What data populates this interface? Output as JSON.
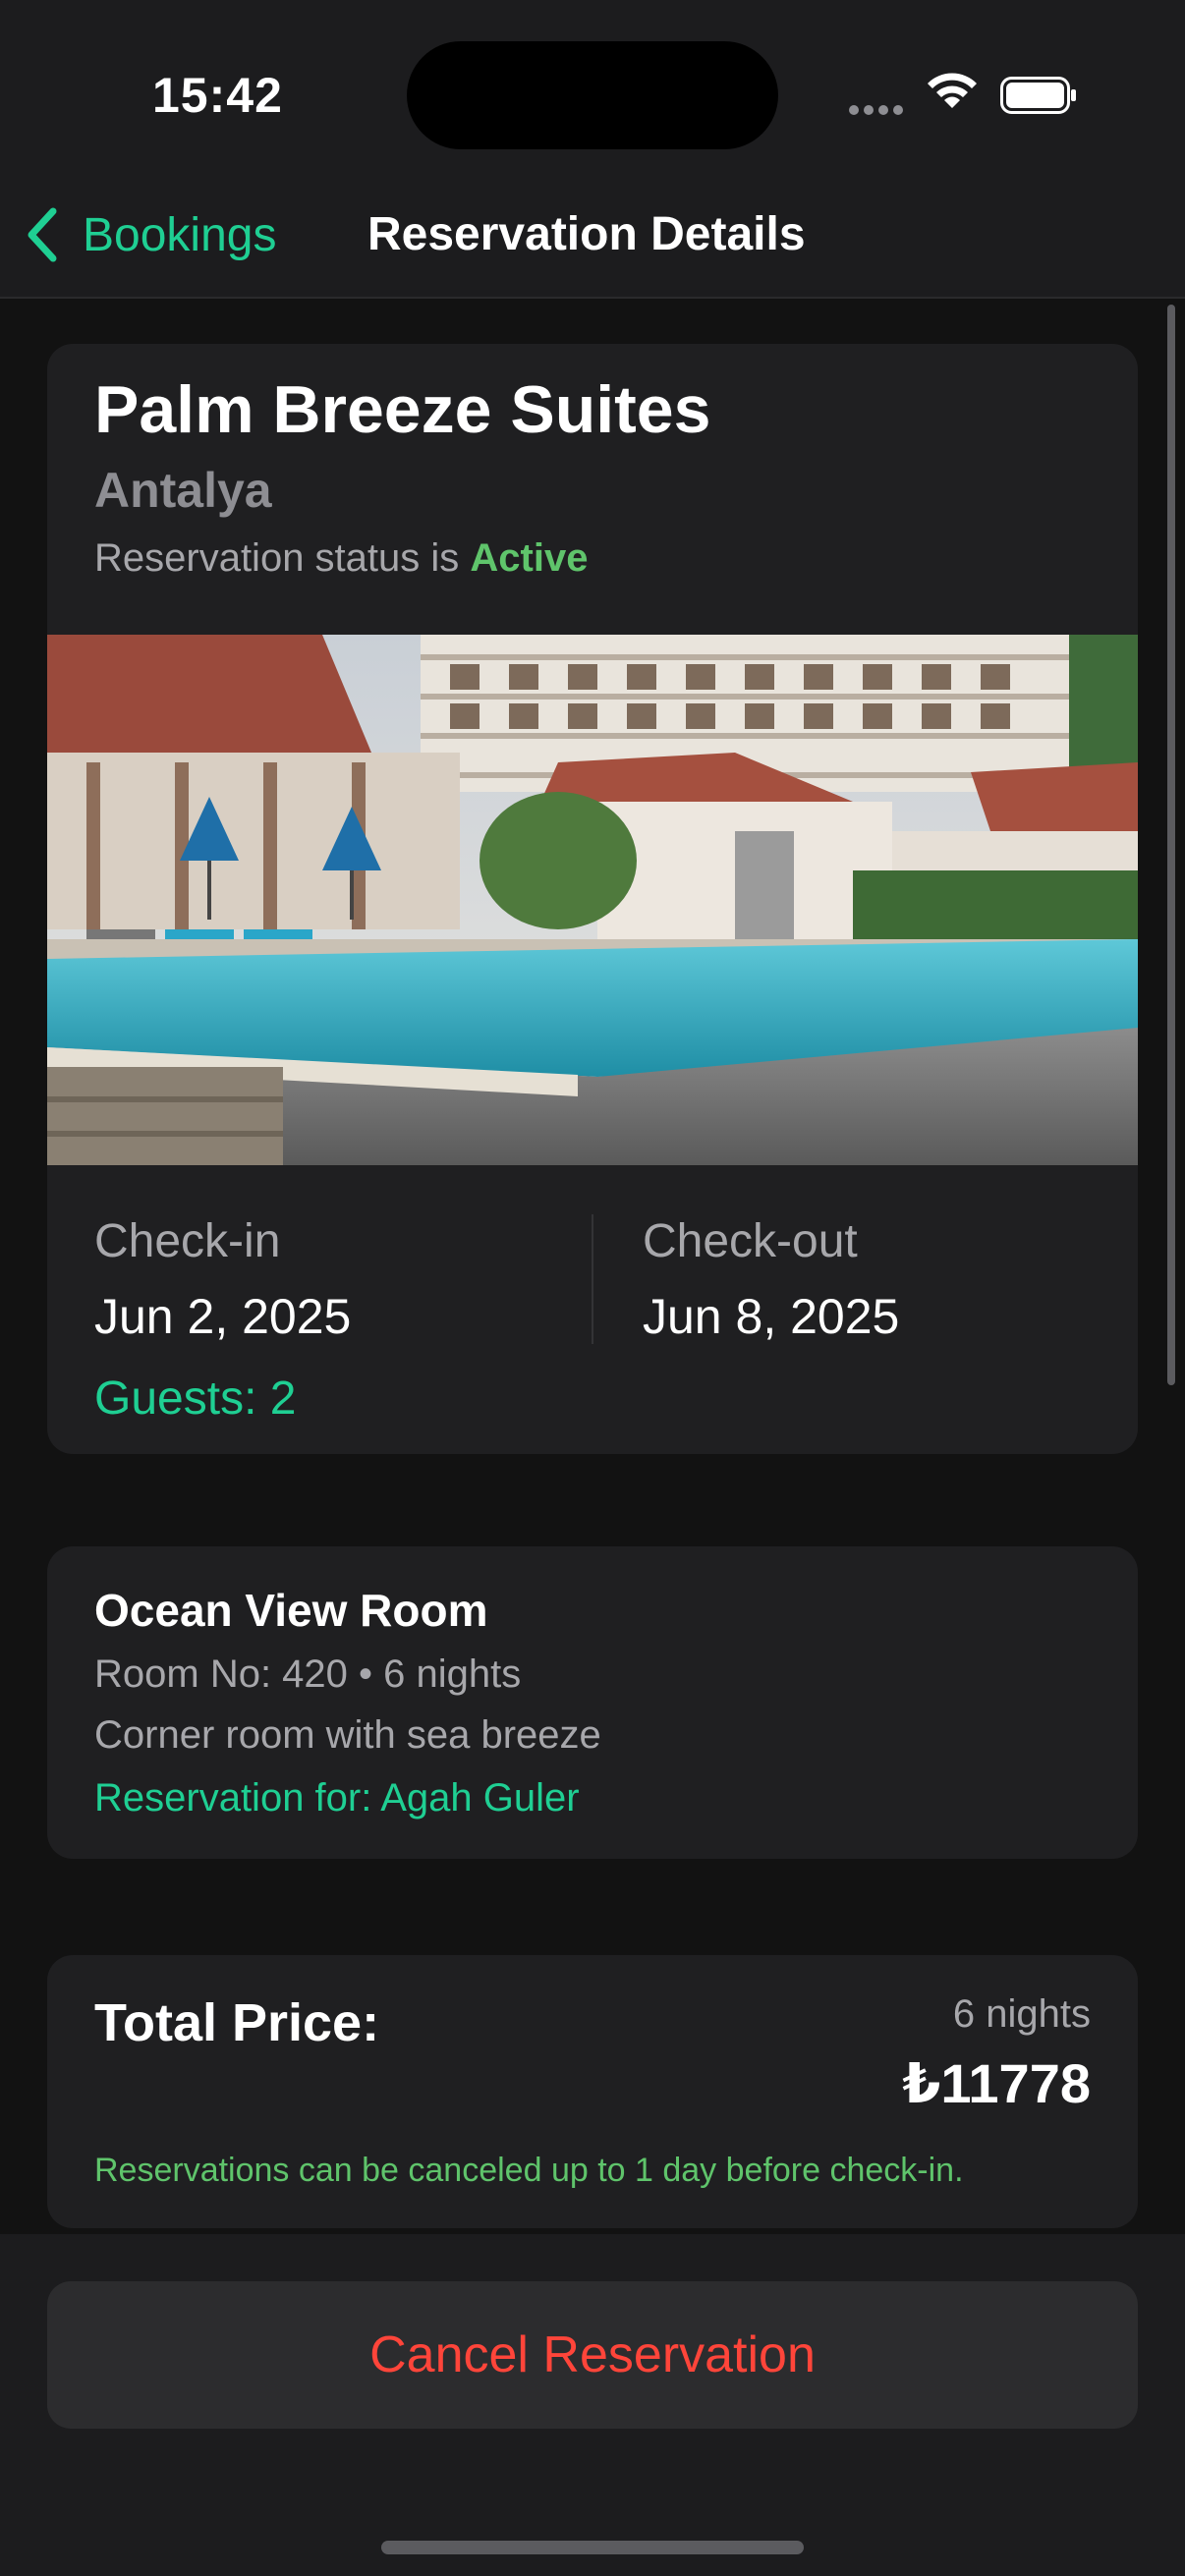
{
  "status_bar": {
    "time": "15:42"
  },
  "nav": {
    "back_label": "Bookings",
    "title": "Reservation Details"
  },
  "hotel": {
    "name": "Palm Breeze Suites",
    "city": "Antalya",
    "status_prefix": "Reservation status is",
    "status_value": "Active",
    "photo_icon": "hotel-pool-photo"
  },
  "dates": {
    "checkin_label": "Check-in",
    "checkin_value": "Jun 2, 2025",
    "checkout_label": "Check-out",
    "checkout_value": "Jun 8, 2025",
    "guests": "Guests: 2"
  },
  "room": {
    "title": "Ocean View Room",
    "number_nights": "Room No: 420 • 6 nights",
    "description": "Corner room with sea breeze",
    "reservation_for": "Reservation for: Agah Guler"
  },
  "price": {
    "label": "Total Price:",
    "nights": "6 nights",
    "amount": "₺11778",
    "policy": "Reservations can be canceled up to 1 day before check-in."
  },
  "actions": {
    "cancel_label": "Cancel Reservation"
  },
  "colors": {
    "accent": "#1fcf93",
    "active": "#5fc46b",
    "destructive": "#ff453a",
    "background": "#121212",
    "card": "#1f1f21"
  }
}
